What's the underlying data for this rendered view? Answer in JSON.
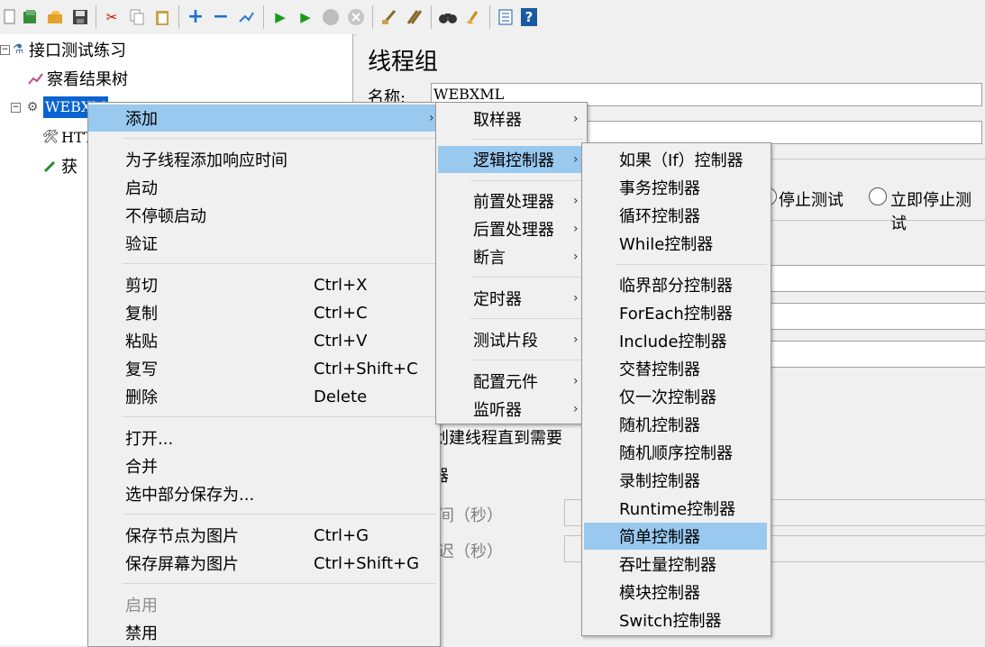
{
  "toolbar": {
    "icons": [
      "new-icon",
      "templates-icon",
      "open-icon",
      "save-icon",
      "cut-icon",
      "copy-icon",
      "paste-icon",
      "expand-icon",
      "collapse-icon",
      "toggle-icon",
      "start-icon",
      "start-no-pause-icon",
      "stop-icon",
      "shutdown-icon",
      "clear-icon",
      "clear-all-icon",
      "search-icon",
      "reset-search-icon",
      "function-helper-icon",
      "help-icon"
    ],
    "glyphs": {
      "expand": "+",
      "collapse": "−",
      "start": "▶",
      "stop": "STOP",
      "shutdown": "✕",
      "help": "?",
      "search": "👓",
      "clear": "🧹"
    }
  },
  "tree": {
    "root": "接口测试练习",
    "items": [
      {
        "label": "察看结果树"
      },
      {
        "label": "WEBXM"
      },
      {
        "label": "HTT"
      },
      {
        "label": "获"
      }
    ]
  },
  "panel": {
    "title": "线程组",
    "name_label": "名称:",
    "name_value": "WEBXML",
    "radio_stop_test": "停止测试",
    "radio_stop_now": "立即停止测试",
    "delay_create": "创建线程直到需要",
    "scheduler": "器",
    "duration": "间（秒）",
    "startup_delay": "迟（秒）"
  },
  "context_menu": {
    "items": [
      {
        "label": "添加",
        "submenu": true
      },
      {
        "label": "为子线程添加响应时间"
      },
      {
        "label": "启动"
      },
      {
        "label": "不停顿启动"
      },
      {
        "label": "验证"
      },
      {
        "label": "剪切",
        "accel": "Ctrl+X"
      },
      {
        "label": "复制",
        "accel": "Ctrl+C"
      },
      {
        "label": "粘贴",
        "accel": "Ctrl+V"
      },
      {
        "label": "复写",
        "accel": "Ctrl+Shift+C"
      },
      {
        "label": "删除",
        "accel": "Delete"
      },
      {
        "label": "打开..."
      },
      {
        "label": "合并"
      },
      {
        "label": "选中部分保存为..."
      },
      {
        "label": "保存节点为图片",
        "accel": "Ctrl+G"
      },
      {
        "label": "保存屏幕为图片",
        "accel": "Ctrl+Shift+G"
      },
      {
        "label": "启用",
        "disabled": true
      },
      {
        "label": "禁用"
      }
    ]
  },
  "add_menu": {
    "items": [
      {
        "label": "取样器"
      },
      {
        "label": "逻辑控制器"
      },
      {
        "label": "前置处理器"
      },
      {
        "label": "后置处理器"
      },
      {
        "label": "断言"
      },
      {
        "label": "定时器"
      },
      {
        "label": "测试片段"
      },
      {
        "label": "配置元件"
      },
      {
        "label": "监听器"
      }
    ]
  },
  "logic_menu": {
    "items": [
      {
        "label": "如果（If）控制器"
      },
      {
        "label": "事务控制器"
      },
      {
        "label": "循环控制器"
      },
      {
        "label": "While控制器"
      },
      {
        "label": "临界部分控制器"
      },
      {
        "label": "ForEach控制器"
      },
      {
        "label": "Include控制器"
      },
      {
        "label": "交替控制器"
      },
      {
        "label": "仅一次控制器"
      },
      {
        "label": "随机控制器"
      },
      {
        "label": "随机顺序控制器"
      },
      {
        "label": "录制控制器"
      },
      {
        "label": "Runtime控制器"
      },
      {
        "label": "简单控制器"
      },
      {
        "label": "吞吐量控制器"
      },
      {
        "label": "模块控制器"
      },
      {
        "label": "Switch控制器"
      }
    ]
  },
  "colors": {
    "highlight": "#99c9ef",
    "selection": "#0a64d0"
  }
}
